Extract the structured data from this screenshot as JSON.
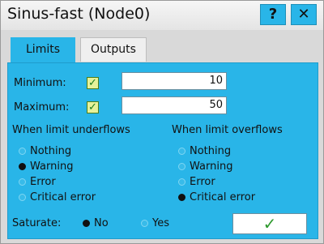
{
  "window": {
    "title": "Sinus-fast (Node0)",
    "help_label": "?",
    "close_label": "✕"
  },
  "tabs": [
    {
      "label": "Limits",
      "active": true
    },
    {
      "label": "Outputs",
      "active": false
    }
  ],
  "limits": {
    "minimum": {
      "label": "Minimum:",
      "checked": true,
      "value": "10"
    },
    "maximum": {
      "label": "Maximum:",
      "checked": true,
      "value": "50"
    }
  },
  "underflow": {
    "heading": "When limit underflows",
    "options": [
      "Nothing",
      "Warning",
      "Error",
      "Critical error"
    ],
    "selected": "Warning"
  },
  "overflow": {
    "heading": "When limit overflows",
    "options": [
      "Nothing",
      "Warning",
      "Error",
      "Critical error"
    ],
    "selected": "Critical error"
  },
  "saturate": {
    "label": "Saturate:",
    "options": [
      "No",
      "Yes"
    ],
    "selected": "No"
  },
  "ok_button": {
    "symbol": "✓"
  },
  "colors": {
    "accent": "#29b5e8",
    "check_green": "#2e9a2e"
  },
  "icons": {
    "help": "question-icon",
    "close": "close-icon",
    "ok": "checkmark-icon"
  }
}
